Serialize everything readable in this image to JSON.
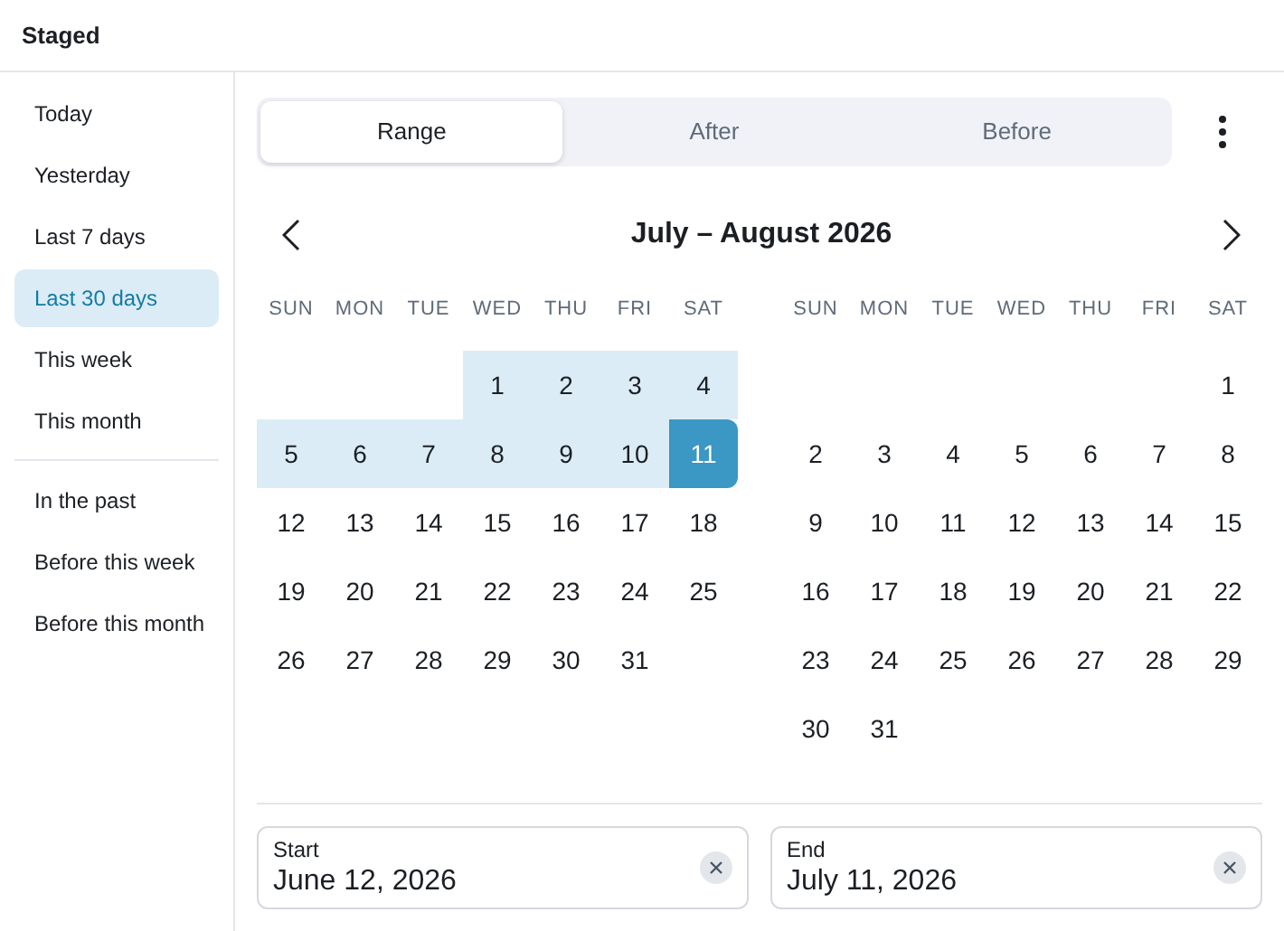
{
  "header": {
    "title": "Staged"
  },
  "sidebar": {
    "groups": [
      {
        "items": [
          {
            "label": "Today",
            "selected": false
          },
          {
            "label": "Yesterday",
            "selected": false
          },
          {
            "label": "Last 7 days",
            "selected": false
          },
          {
            "label": "Last 30 days",
            "selected": true
          },
          {
            "label": "This week",
            "selected": false
          },
          {
            "label": "This month",
            "selected": false
          }
        ]
      },
      {
        "items": [
          {
            "label": "In the past",
            "selected": false
          },
          {
            "label": "Before this week",
            "selected": false
          },
          {
            "label": "Before this month",
            "selected": false
          }
        ]
      }
    ]
  },
  "tabs": [
    {
      "label": "Range",
      "selected": true
    },
    {
      "label": "After",
      "selected": false
    },
    {
      "label": "Before",
      "selected": false
    }
  ],
  "calendar": {
    "title": "July – August 2026",
    "months": [
      {
        "weekdays": [
          "SUN",
          "MON",
          "TUE",
          "WED",
          "THU",
          "FRI",
          "SAT"
        ],
        "weeks": [
          [
            {
              "day": "1",
              "in_range": true,
              "selected": false
            },
            {
              "day": "2",
              "in_range": true,
              "selected": false
            },
            {
              "day": "3",
              "in_range": true,
              "selected": false
            },
            {
              "day": "4",
              "in_range": true,
              "selected": false
            }
          ],
          [
            {
              "day": "5",
              "in_range": true,
              "selected": false
            },
            {
              "day": "6",
              "in_range": true,
              "selected": false
            },
            {
              "day": "7",
              "in_range": true,
              "selected": false
            },
            {
              "day": "8",
              "in_range": true,
              "selected": false
            },
            {
              "day": "9",
              "in_range": true,
              "selected": false
            },
            {
              "day": "10",
              "in_range": true,
              "selected": false
            },
            {
              "day": "11",
              "in_range": true,
              "selected": true
            }
          ],
          [
            {
              "day": "12",
              "in_range": false,
              "selected": false
            },
            {
              "day": "13",
              "in_range": false,
              "selected": false
            },
            {
              "day": "14",
              "in_range": false,
              "selected": false
            },
            {
              "day": "15",
              "in_range": false,
              "selected": false
            },
            {
              "day": "16",
              "in_range": false,
              "selected": false
            },
            {
              "day": "17",
              "in_range": false,
              "selected": false
            },
            {
              "day": "18",
              "in_range": false,
              "selected": false
            }
          ],
          [
            {
              "day": "19",
              "in_range": false,
              "selected": false
            },
            {
              "day": "20",
              "in_range": false,
              "selected": false
            },
            {
              "day": "21",
              "in_range": false,
              "selected": false
            },
            {
              "day": "22",
              "in_range": false,
              "selected": false
            },
            {
              "day": "23",
              "in_range": false,
              "selected": false
            },
            {
              "day": "24",
              "in_range": false,
              "selected": false
            },
            {
              "day": "25",
              "in_range": false,
              "selected": false
            }
          ],
          [
            {
              "day": "26",
              "in_range": false,
              "selected": false
            },
            {
              "day": "27",
              "in_range": false,
              "selected": false
            },
            {
              "day": "28",
              "in_range": false,
              "selected": false
            },
            {
              "day": "29",
              "in_range": false,
              "selected": false
            },
            {
              "day": "30",
              "in_range": false,
              "selected": false
            },
            {
              "day": "31",
              "in_range": false,
              "selected": false
            }
          ]
        ]
      },
      {
        "weekdays": [
          "SUN",
          "MON",
          "TUE",
          "WED",
          "THU",
          "FRI",
          "SAT"
        ],
        "weeks": [
          [
            {
              "day": "1",
              "in_range": false,
              "selected": false
            }
          ],
          [
            {
              "day": "2",
              "in_range": false,
              "selected": false
            },
            {
              "day": "3",
              "in_range": false,
              "selected": false
            },
            {
              "day": "4",
              "in_range": false,
              "selected": false
            },
            {
              "day": "5",
              "in_range": false,
              "selected": false
            },
            {
              "day": "6",
              "in_range": false,
              "selected": false
            },
            {
              "day": "7",
              "in_range": false,
              "selected": false
            },
            {
              "day": "8",
              "in_range": false,
              "selected": false
            }
          ],
          [
            {
              "day": "9",
              "in_range": false,
              "selected": false
            },
            {
              "day": "10",
              "in_range": false,
              "selected": false
            },
            {
              "day": "11",
              "in_range": false,
              "selected": false
            },
            {
              "day": "12",
              "in_range": false,
              "selected": false
            },
            {
              "day": "13",
              "in_range": false,
              "selected": false
            },
            {
              "day": "14",
              "in_range": false,
              "selected": false
            },
            {
              "day": "15",
              "in_range": false,
              "selected": false
            }
          ],
          [
            {
              "day": "16",
              "in_range": false,
              "selected": false
            },
            {
              "day": "17",
              "in_range": false,
              "selected": false
            },
            {
              "day": "18",
              "in_range": false,
              "selected": false
            },
            {
              "day": "19",
              "in_range": false,
              "selected": false
            },
            {
              "day": "20",
              "in_range": false,
              "selected": false
            },
            {
              "day": "21",
              "in_range": false,
              "selected": false
            },
            {
              "day": "22",
              "in_range": false,
              "selected": false
            }
          ],
          [
            {
              "day": "23",
              "in_range": false,
              "selected": false
            },
            {
              "day": "24",
              "in_range": false,
              "selected": false
            },
            {
              "day": "25",
              "in_range": false,
              "selected": false
            },
            {
              "day": "26",
              "in_range": false,
              "selected": false
            },
            {
              "day": "27",
              "in_range": false,
              "selected": false
            },
            {
              "day": "28",
              "in_range": false,
              "selected": false
            },
            {
              "day": "29",
              "in_range": false,
              "selected": false
            }
          ],
          [
            {
              "day": "30",
              "in_range": false,
              "selected": false
            },
            {
              "day": "31",
              "in_range": false,
              "selected": false
            }
          ]
        ]
      }
    ]
  },
  "fields": [
    {
      "label": "Start",
      "value": "June 12, 2026"
    },
    {
      "label": "End",
      "value": "July 11, 2026"
    }
  ]
}
